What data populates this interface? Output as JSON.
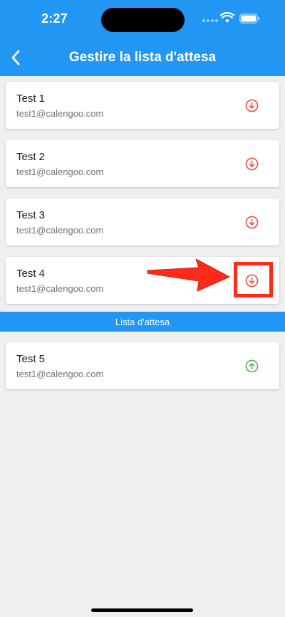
{
  "status_bar": {
    "time": "2:27"
  },
  "header": {
    "title": "Gestire la lista d'attesa"
  },
  "attendees": [
    {
      "name": "Test 1",
      "email": "test1@calengoo.com",
      "action_icon": "arrow-down-circle-icon"
    },
    {
      "name": "Test 2",
      "email": "test1@calengoo.com",
      "action_icon": "arrow-down-circle-icon"
    },
    {
      "name": "Test 3",
      "email": "test1@calengoo.com",
      "action_icon": "arrow-down-circle-icon"
    },
    {
      "name": "Test 4",
      "email": "test1@calengoo.com",
      "action_icon": "arrow-down-circle-icon"
    }
  ],
  "waitlist_section": {
    "title": "Lista d'attesa"
  },
  "waitlist": [
    {
      "name": "Test 5",
      "email": "test1@calengoo.com",
      "action_icon": "arrow-up-circle-icon"
    }
  ],
  "colors": {
    "primary": "#2196f3",
    "background": "#efefef",
    "move_down": "#f44336",
    "move_up": "#4caf50",
    "annotation": "#ff2a1a"
  }
}
